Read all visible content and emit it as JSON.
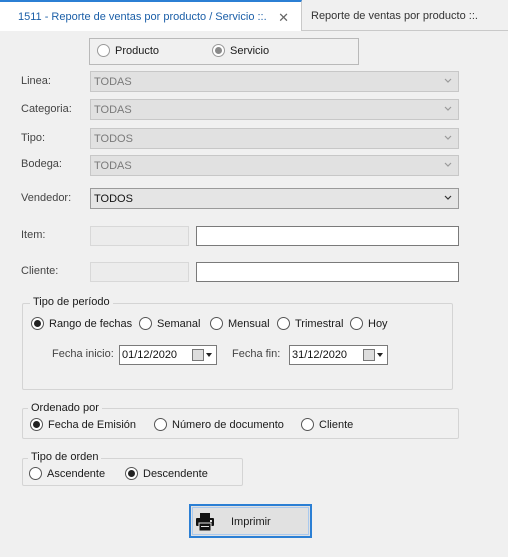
{
  "tabs": [
    {
      "label": "1511 - Reporte de ventas por producto / Servicio ::.",
      "close": "✕"
    },
    {
      "label": "Reporte de ventas por producto ::."
    }
  ],
  "kind": {
    "producto": "Producto",
    "servicio": "Servicio",
    "selected": "Servicio"
  },
  "fields": {
    "linea": {
      "label": "Linea:",
      "value": "TODAS"
    },
    "categoria": {
      "label": "Categoria:",
      "value": "TODAS"
    },
    "tipo": {
      "label": "Tipo:",
      "value": "TODOS"
    },
    "bodega": {
      "label": "Bodega:",
      "value": "TODAS"
    },
    "vendedor": {
      "label": "Vendedor:",
      "value": "TODOS"
    },
    "item": {
      "label": "Item:",
      "code": "",
      "value": ""
    },
    "cliente": {
      "label": "Cliente:",
      "code": "",
      "value": ""
    }
  },
  "periodo": {
    "title": "Tipo de período",
    "options": [
      "Rango de fechas",
      "Semanal",
      "Mensual",
      "Trimestral",
      "Hoy"
    ],
    "selected": "Rango de fechas",
    "fecha_inicio_label": "Fecha inicio:",
    "fecha_inicio": "01/12/2020",
    "fecha_fin_label": "Fecha fin:",
    "fecha_fin": "31/12/2020"
  },
  "ordenado": {
    "title": "Ordenado por",
    "options": [
      "Fecha de Emisión",
      "Número de documento",
      "Cliente"
    ],
    "selected": "Fecha de Emisión"
  },
  "orden": {
    "title": "Tipo de orden",
    "options": [
      "Ascendente",
      "Descendente"
    ],
    "selected": "Descendente"
  },
  "print_button": {
    "label": "Imprimir",
    "icon": "printer-icon"
  }
}
